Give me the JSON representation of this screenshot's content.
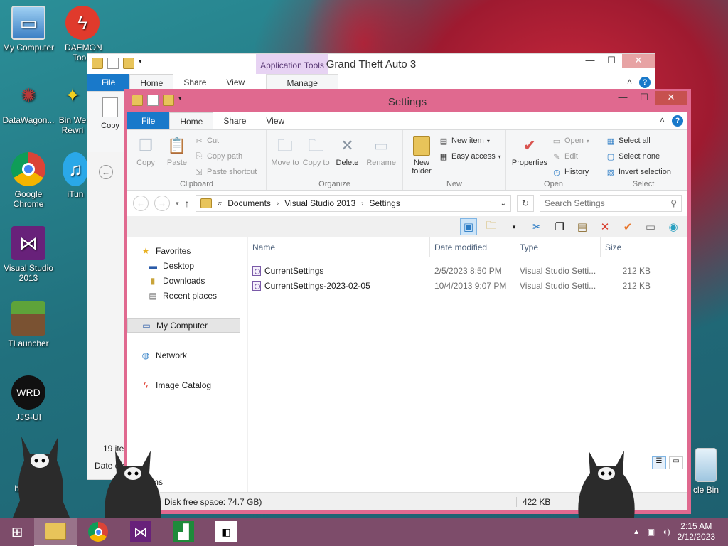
{
  "desktop": {
    "icons": [
      {
        "label": "My Computer"
      },
      {
        "label": "DAEMON Tools"
      },
      {
        "label": "DataWagon..."
      },
      {
        "label": "Bin We Rewri"
      },
      {
        "label": "Google Chrome"
      },
      {
        "label": "iTun"
      },
      {
        "label": "Visual Studio 2013"
      },
      {
        "label": "TLauncher"
      },
      {
        "label": "JJS-UI"
      },
      {
        "label": "bl"
      },
      {
        "label": "cle Bin"
      }
    ]
  },
  "back_window": {
    "title": "Grand Theft Auto 3",
    "context_tab_header": "Application Tools",
    "tabs": [
      "File",
      "Home",
      "Share",
      "View",
      "Manage"
    ],
    "copy_label": "Copy",
    "status_items": "19 ite",
    "col_fragment": "Date cre"
  },
  "window": {
    "title": "Settings",
    "tabs": [
      "File",
      "Home",
      "Share",
      "View"
    ],
    "ribbon": {
      "clipboard": {
        "copy": "Copy",
        "paste": "Paste",
        "cut": "Cut",
        "copy_path": "Copy path",
        "paste_shortcut": "Paste shortcut",
        "label": "Clipboard"
      },
      "organize": {
        "move_to": "Move to",
        "copy_to": "Copy to",
        "delete": "Delete",
        "rename": "Rename",
        "label": "Organize"
      },
      "new": {
        "new_folder": "New folder",
        "new_item": "New item",
        "easy_access": "Easy access",
        "label": "New"
      },
      "open": {
        "properties": "Properties",
        "open": "Open",
        "edit": "Edit",
        "history": "History",
        "label": "Open"
      },
      "select": {
        "select_all": "Select all",
        "select_none": "Select none",
        "invert_selection": "Invert selection",
        "label": "Select"
      }
    },
    "address": {
      "prefix": "«",
      "crumbs": [
        "Documents",
        "Visual Studio 2013",
        "Settings"
      ],
      "search_placeholder": "Search Settings"
    },
    "nav": {
      "favorites": "Favorites",
      "desktop": "Desktop",
      "downloads": "Downloads",
      "recent": "Recent places",
      "my_computer": "My Computer",
      "network": "Network",
      "image_catalog": "Image Catalog"
    },
    "columns": {
      "name": "Name",
      "date": "Date modified",
      "type": "Type",
      "size": "Size"
    },
    "files": [
      {
        "name": "CurrentSettings",
        "date": "2/5/2023 8:50 PM",
        "type": "Visual Studio Setti...",
        "size": "212 KB"
      },
      {
        "name": "CurrentSettings-2023-02-05",
        "date": "10/4/2013 9:07 PM",
        "type": "Visual Studio Setti...",
        "size": "212 KB"
      }
    ],
    "status": {
      "left_fragment": "ms",
      "disk": "Disk free space: 74.7 GB)",
      "size": "422 KB"
    }
  },
  "taskbar": {
    "time": "2:15 AM",
    "date": "2/12/2023"
  },
  "colors": {
    "window_border": "#e0698f",
    "taskbar": "#7d4c6a",
    "file_tab": "#1979ca"
  }
}
